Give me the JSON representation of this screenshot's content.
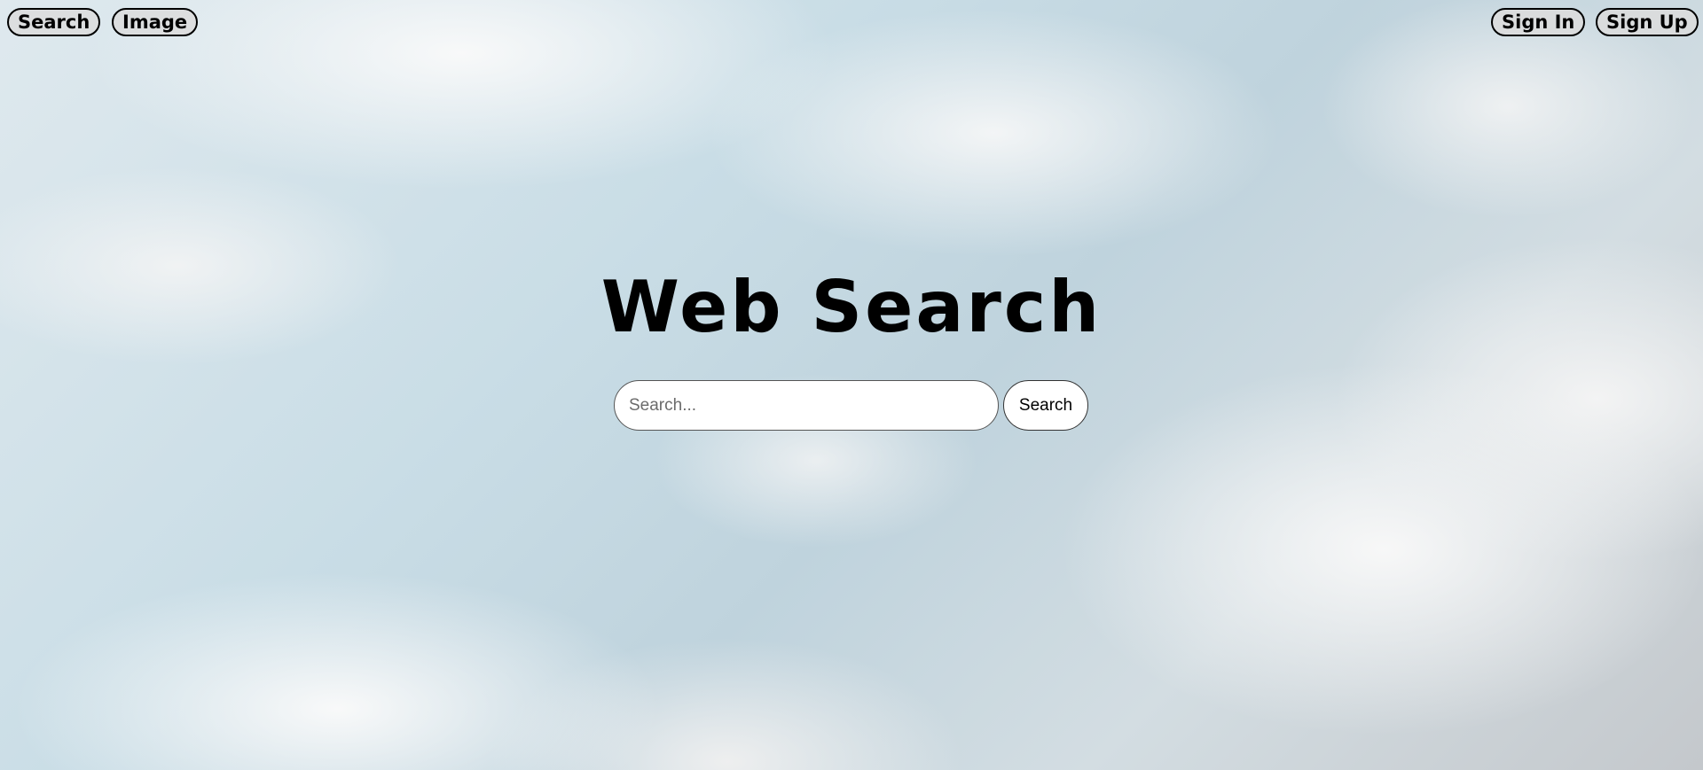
{
  "nav": {
    "left": [
      {
        "label": "Search"
      },
      {
        "label": "Image"
      }
    ],
    "right": [
      {
        "label": "Sign In"
      },
      {
        "label": "Sign Up"
      }
    ]
  },
  "main": {
    "title": "Web Search",
    "search": {
      "placeholder": "Search...",
      "value": "",
      "button_label": "Search"
    }
  }
}
